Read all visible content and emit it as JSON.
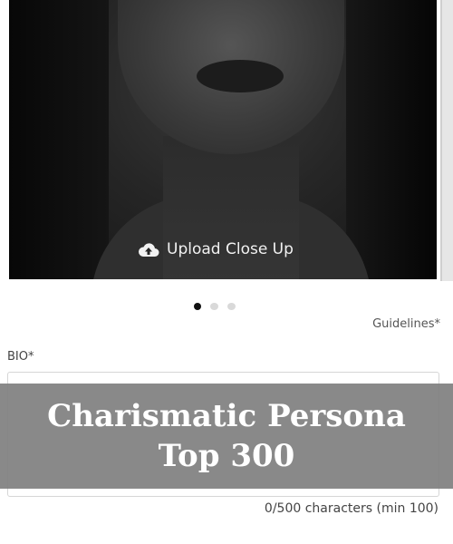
{
  "photo": {
    "upload_label": "Upload Close Up",
    "upload_icon": "cloud-upload-icon"
  },
  "carousel": {
    "total": 3,
    "active_index": 0
  },
  "guidelines_label": "Guidelines*",
  "bio": {
    "label": "BIO*",
    "value": "",
    "char_count": "0/500 characters (min 100)"
  },
  "banner": {
    "line1": "Charismatic Persona",
    "line2": "Top 300"
  },
  "colors": {
    "banner_bg": "#808080",
    "active_dot": "#111111",
    "inactive_dot": "#d9d9d9"
  }
}
